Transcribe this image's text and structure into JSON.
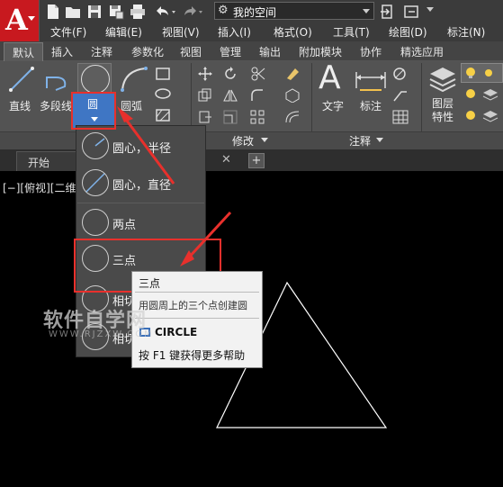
{
  "titlebar": {
    "workspace_label": "我的空间",
    "app_logo_letter": "A"
  },
  "menu": [
    {
      "label": "文件(F)"
    },
    {
      "label": "编辑(E)"
    },
    {
      "label": "视图(V)"
    },
    {
      "label": "插入(I)"
    },
    {
      "label": "格式(O)"
    },
    {
      "label": "工具(T)"
    },
    {
      "label": "绘图(D)"
    },
    {
      "label": "标注(N)"
    }
  ],
  "ribbon_tabs": [
    {
      "label": "默认"
    },
    {
      "label": "插入"
    },
    {
      "label": "注释"
    },
    {
      "label": "参数化"
    },
    {
      "label": "视图"
    },
    {
      "label": "管理"
    },
    {
      "label": "输出"
    },
    {
      "label": "附加模块"
    },
    {
      "label": "协作"
    },
    {
      "label": "精选应用"
    }
  ],
  "ribbon": {
    "line_label": "直线",
    "polyline_label": "多段线",
    "circle_label": "圆",
    "arc_label": "圆弧",
    "modify_panel_label": "修改",
    "text_label": "文字",
    "dimension_label": "标注",
    "annotation_panel_label": "注释",
    "layer_props_label": "图层\n特性"
  },
  "doc_tabs": {
    "start_label": "开始"
  },
  "viewport": {
    "label": "[−][俯视][二维线"
  },
  "circle_dropdown": {
    "items": [
      {
        "label": "圆心，半径"
      },
      {
        "label": "圆心，直径"
      },
      {
        "label": "两点"
      },
      {
        "label": "三点"
      },
      {
        "label": "相切"
      },
      {
        "label": "相切"
      }
    ]
  },
  "tooltip": {
    "title": "三点",
    "description": "用圆周上的三个点创建圆",
    "command": "CIRCLE",
    "help": "按 F1 键获得更多帮助"
  },
  "watermark": {
    "text": "软件自学网",
    "url": "WWW.RJZXW.COM"
  },
  "colors": {
    "highlight": "#e8302c",
    "app_logo": "#c8191f",
    "ribbon": "#535353",
    "canvas": "#000000"
  }
}
